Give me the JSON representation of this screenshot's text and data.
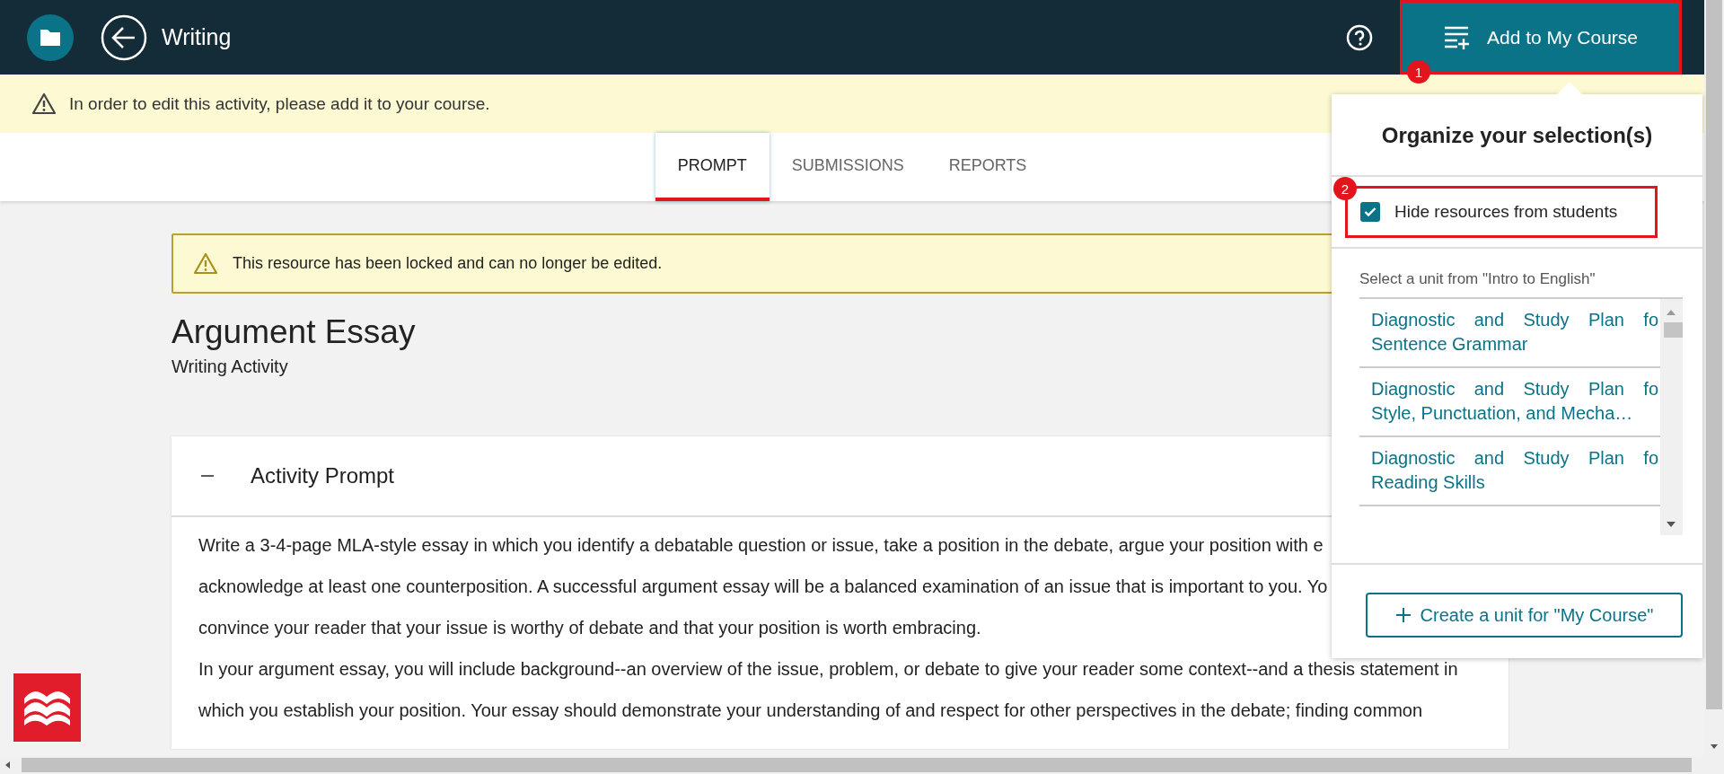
{
  "top_bar": {
    "title": "Writing",
    "add_button": {
      "label": "Add to My Course",
      "highlighted": true,
      "badge": "1"
    }
  },
  "notice": {
    "text": "In order to edit this activity, please add it to your course."
  },
  "tabs": [
    {
      "label": "PROMPT",
      "selected": true
    },
    {
      "label": "SUBMISSIONS",
      "selected": false
    },
    {
      "label": "REPORTS",
      "selected": false
    }
  ],
  "locked_banner": {
    "text": "This resource has been locked and can no longer be edited."
  },
  "activity": {
    "title": "Argument Essay",
    "subtitle": "Writing Activity"
  },
  "prompt_card": {
    "heading": "Activity Prompt",
    "expanded": true,
    "lines": [
      "Write a 3-4-page MLA-style essay in which you identify a debatable question or issue, take a position in the debate, argue your position with e",
      "acknowledge at least one counterposition. A successful argument essay will be a balanced examination of an issue that is important to you. Yo",
      "convince your reader that your issue is worthy of debate and that your position is worth embracing.",
      "In your argument essay, you will include background--an overview of the issue, problem, or debate to give your reader some context--and a thesis statement in",
      "which you establish your position. Your essay should demonstrate your understanding of and respect for other perspectives in the debate; finding common"
    ]
  },
  "popover": {
    "title": "Organize your selection(s)",
    "hide_option": {
      "label": "Hide resources from students",
      "checked": true,
      "highlighted": true,
      "badge": "2"
    },
    "unit_prompt": "Select a unit from \"Intro to English\"",
    "units": [
      {
        "lines": [
          "Diagnostic and Study Plan fo",
          "Sentence Grammar"
        ]
      },
      {
        "lines": [
          "Diagnostic and Study Plan fo",
          "Style, Punctuation, and Mecha…"
        ]
      },
      {
        "lines": [
          "Diagnostic and Study Plan fo",
          "Reading Skills"
        ]
      }
    ],
    "create_button": "Create a unit for \"My Course\""
  }
}
